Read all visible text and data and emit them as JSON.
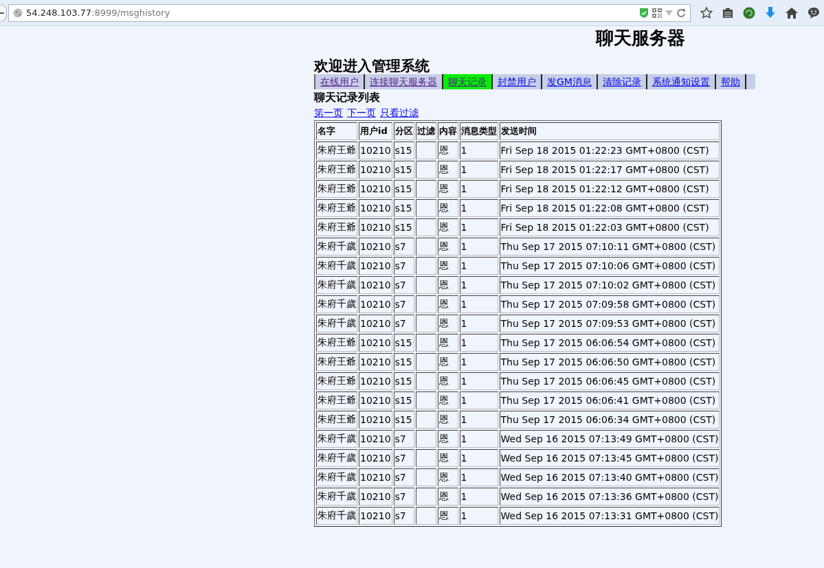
{
  "browser": {
    "url_host": "54.248.103.77",
    "url_path": ":8999/msghistory"
  },
  "header": {
    "title": "聊天服务器",
    "welcome": "欢迎进入管理系统"
  },
  "tabs": [
    {
      "label": "在线用户",
      "selected": false,
      "visited": true
    },
    {
      "label": "连接聊天服务器",
      "selected": false,
      "visited": true
    },
    {
      "label": "聊天记录",
      "selected": true,
      "visited": true
    },
    {
      "label": "封禁用户",
      "selected": false,
      "visited": false
    },
    {
      "label": "发GM消息",
      "selected": false,
      "visited": false
    },
    {
      "label": "清除记录",
      "selected": false,
      "visited": false
    },
    {
      "label": "系统通知设置",
      "selected": false,
      "visited": false
    },
    {
      "label": "帮助",
      "selected": false,
      "visited": false
    }
  ],
  "section_title": "聊天记录列表",
  "pager_links": [
    "第一页",
    "下一页",
    "只看过滤"
  ],
  "table": {
    "columns": [
      "名字",
      "用户id",
      "分区",
      "过滤",
      "内容",
      "消息类型",
      "发送时间"
    ],
    "rows": [
      {
        "name": "朱府王爺",
        "user_id": "10210",
        "zone": "s15",
        "content": "恩",
        "msg_type": "1",
        "sent_time": "Fri Sep 18 2015 01:22:23 GMT+0800 (CST)"
      },
      {
        "name": "朱府王爺",
        "user_id": "10210",
        "zone": "s15",
        "content": "恩",
        "msg_type": "1",
        "sent_time": "Fri Sep 18 2015 01:22:17 GMT+0800 (CST)"
      },
      {
        "name": "朱府王爺",
        "user_id": "10210",
        "zone": "s15",
        "content": "恩",
        "msg_type": "1",
        "sent_time": "Fri Sep 18 2015 01:22:12 GMT+0800 (CST)"
      },
      {
        "name": "朱府王爺",
        "user_id": "10210",
        "zone": "s15",
        "content": "恩",
        "msg_type": "1",
        "sent_time": "Fri Sep 18 2015 01:22:08 GMT+0800 (CST)"
      },
      {
        "name": "朱府王爺",
        "user_id": "10210",
        "zone": "s15",
        "content": "恩",
        "msg_type": "1",
        "sent_time": "Fri Sep 18 2015 01:22:03 GMT+0800 (CST)"
      },
      {
        "name": "朱府千歲",
        "user_id": "10210",
        "zone": "s7",
        "content": "恩",
        "msg_type": "1",
        "sent_time": "Thu Sep 17 2015 07:10:11 GMT+0800 (CST)"
      },
      {
        "name": "朱府千歲",
        "user_id": "10210",
        "zone": "s7",
        "content": "恩",
        "msg_type": "1",
        "sent_time": "Thu Sep 17 2015 07:10:06 GMT+0800 (CST)"
      },
      {
        "name": "朱府千歲",
        "user_id": "10210",
        "zone": "s7",
        "content": "恩",
        "msg_type": "1",
        "sent_time": "Thu Sep 17 2015 07:10:02 GMT+0800 (CST)"
      },
      {
        "name": "朱府千歲",
        "user_id": "10210",
        "zone": "s7",
        "content": "恩",
        "msg_type": "1",
        "sent_time": "Thu Sep 17 2015 07:09:58 GMT+0800 (CST)"
      },
      {
        "name": "朱府千歲",
        "user_id": "10210",
        "zone": "s7",
        "content": "恩",
        "msg_type": "1",
        "sent_time": "Thu Sep 17 2015 07:09:53 GMT+0800 (CST)"
      },
      {
        "name": "朱府王爺",
        "user_id": "10210",
        "zone": "s15",
        "content": "恩",
        "msg_type": "1",
        "sent_time": "Thu Sep 17 2015 06:06:54 GMT+0800 (CST)"
      },
      {
        "name": "朱府王爺",
        "user_id": "10210",
        "zone": "s15",
        "content": "恩",
        "msg_type": "1",
        "sent_time": "Thu Sep 17 2015 06:06:50 GMT+0800 (CST)"
      },
      {
        "name": "朱府王爺",
        "user_id": "10210",
        "zone": "s15",
        "content": "恩",
        "msg_type": "1",
        "sent_time": "Thu Sep 17 2015 06:06:45 GMT+0800 (CST)"
      },
      {
        "name": "朱府王爺",
        "user_id": "10210",
        "zone": "s15",
        "content": "恩",
        "msg_type": "1",
        "sent_time": "Thu Sep 17 2015 06:06:41 GMT+0800 (CST)"
      },
      {
        "name": "朱府王爺",
        "user_id": "10210",
        "zone": "s15",
        "content": "恩",
        "msg_type": "1",
        "sent_time": "Thu Sep 17 2015 06:06:34 GMT+0800 (CST)"
      },
      {
        "name": "朱府千歲",
        "user_id": "10210",
        "zone": "s7",
        "content": "恩",
        "msg_type": "1",
        "sent_time": "Wed Sep 16 2015 07:13:49 GMT+0800 (CST)"
      },
      {
        "name": "朱府千歲",
        "user_id": "10210",
        "zone": "s7",
        "content": "恩",
        "msg_type": "1",
        "sent_time": "Wed Sep 16 2015 07:13:45 GMT+0800 (CST)"
      },
      {
        "name": "朱府千歲",
        "user_id": "10210",
        "zone": "s7",
        "content": "恩",
        "msg_type": "1",
        "sent_time": "Wed Sep 16 2015 07:13:40 GMT+0800 (CST)"
      },
      {
        "name": "朱府千歲",
        "user_id": "10210",
        "zone": "s7",
        "content": "恩",
        "msg_type": "1",
        "sent_time": "Wed Sep 16 2015 07:13:36 GMT+0800 (CST)"
      },
      {
        "name": "朱府千歲",
        "user_id": "10210",
        "zone": "s7",
        "content": "恩",
        "msg_type": "1",
        "sent_time": "Wed Sep 16 2015 07:13:31 GMT+0800 (CST)"
      }
    ]
  }
}
